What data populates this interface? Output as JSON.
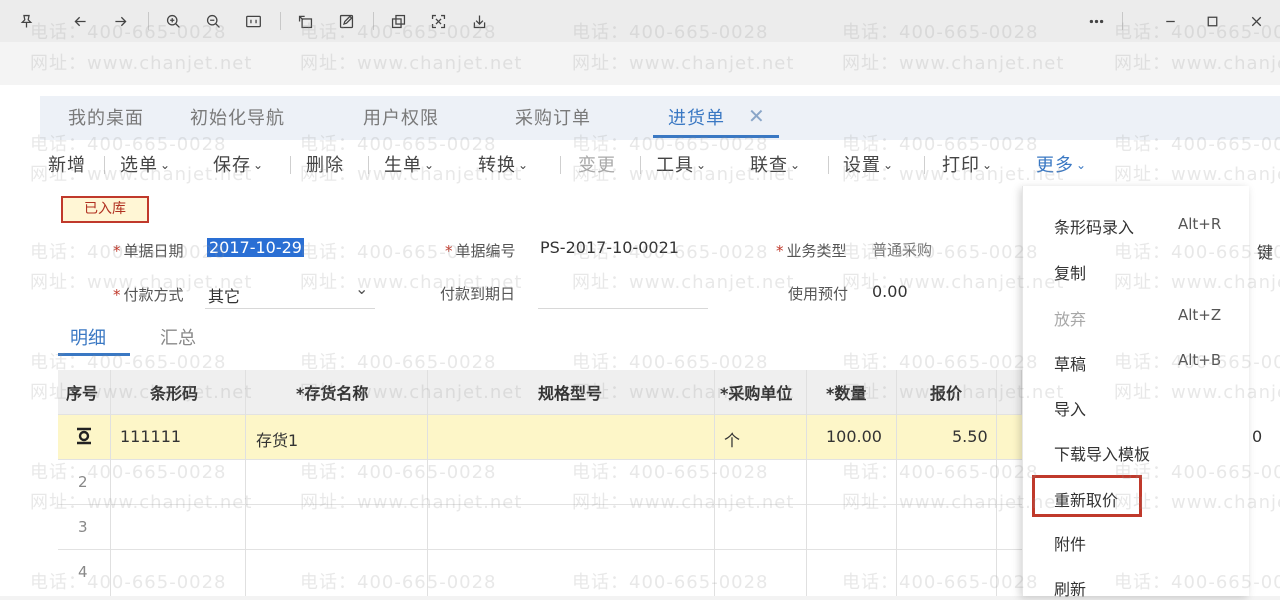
{
  "viewer": {
    "toolbar_icons": [
      "pin-icon",
      "back-icon",
      "forward-icon",
      "zoom-in-icon",
      "zoom-out-icon",
      "fit-icon",
      "rotate-icon",
      "edit-icon",
      "copy-text-icon",
      "crop-icon",
      "save-icon",
      "more-icon"
    ],
    "window_controls": [
      "minimize-icon",
      "maximize-icon",
      "close-icon"
    ]
  },
  "app_tabs": [
    "我的桌面",
    "初始化导航",
    "用户权限",
    "采购订单",
    "进货单"
  ],
  "active_tab_close": "✕",
  "toolbar": {
    "new": "新增",
    "select": "选单",
    "save": "保存",
    "delete": "删除",
    "generate": "生单",
    "convert": "转换",
    "change": "变更",
    "tools": "工具",
    "query": "联查",
    "settings": "设置",
    "print": "打印",
    "more": "更多",
    "chevron": "⌄"
  },
  "status_stamp": "已入库",
  "header_fields": {
    "date_label": "单据日期",
    "date_value": "2017-10-29",
    "number_label": "单据编号",
    "number_value": "PS-2017-10-0021",
    "biztype_label": "业务类型",
    "biztype_value": "普通采购",
    "payment_label": "付款方式",
    "payment_value": "其它",
    "due_label": "付款到期日",
    "prepay_label": "使用预付",
    "prepay_value": "0.00",
    "required_mark": "*",
    "select_arrow": "⌄",
    "cut_off_label": "键"
  },
  "sub_tabs": [
    "明细",
    "汇总"
  ],
  "grid": {
    "headers": [
      "序号",
      "条形码",
      "*存货名称",
      "规格型号",
      "*采购单位",
      "*数量",
      "报价"
    ],
    "row1": {
      "barcode": "111111",
      "name": "存货1",
      "unit": "个",
      "qty": "100.00",
      "price": "5.50",
      "overflow": "0"
    },
    "row_numbers": [
      "2",
      "3",
      "4"
    ]
  },
  "more_menu": {
    "items": [
      {
        "label": "条形码录入",
        "shortcut": "Alt+R",
        "dim": false
      },
      {
        "label": "复制",
        "shortcut": "",
        "dim": false
      },
      {
        "label": "放弃",
        "shortcut": "Alt+Z",
        "dim": true
      },
      {
        "label": "草稿",
        "shortcut": "Alt+B",
        "dim": false
      },
      {
        "label": "导入",
        "shortcut": "",
        "dim": false
      },
      {
        "label": "下载导入模板",
        "shortcut": "",
        "dim": false
      },
      {
        "label": "重新取价",
        "shortcut": "",
        "dim": false
      },
      {
        "label": "附件",
        "shortcut": "",
        "dim": false
      },
      {
        "label": "刷新",
        "shortcut": "",
        "dim": false
      }
    ]
  },
  "watermark": {
    "phone": "电话：400-665-0028",
    "site": "网址：www.chanjet.net"
  }
}
